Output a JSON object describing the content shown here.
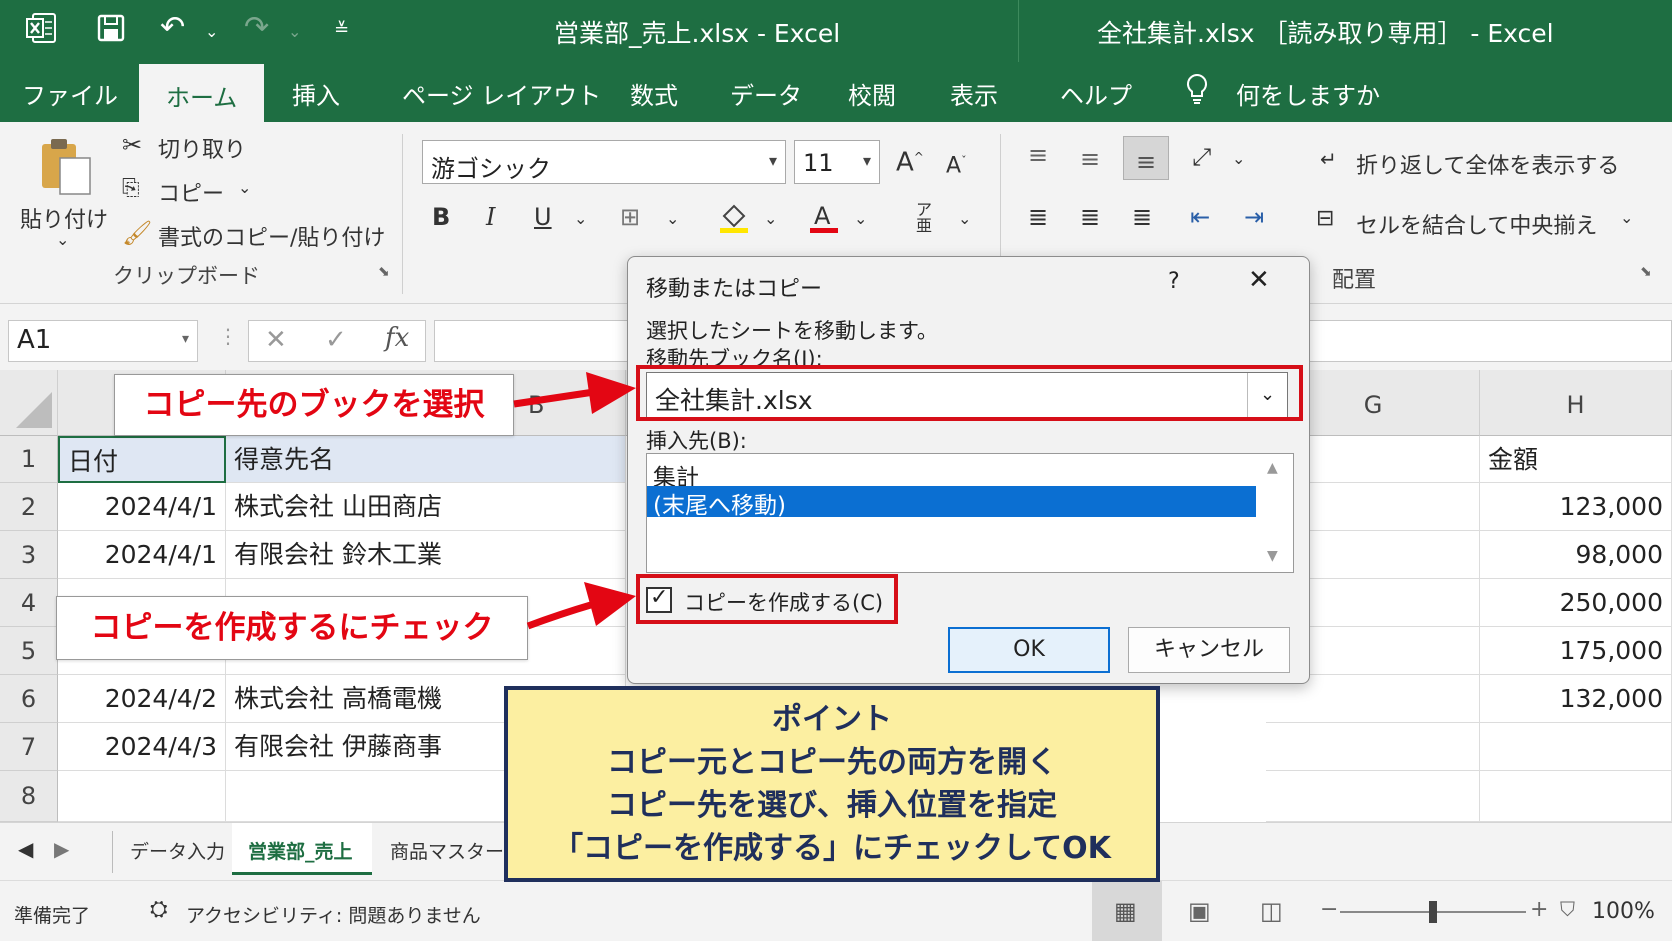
{
  "titlebar": {
    "left_title": "営業部_売上.xlsx  -  Excel",
    "right_title": "全社集計.xlsx ［読み取り専用］ -  Excel"
  },
  "tabs": [
    "ファイル",
    "ホーム",
    "挿入",
    "ページ レイアウト",
    "数式",
    "データ",
    "校閲",
    "表示",
    "ヘルプ"
  ],
  "tellme": "何をしますか",
  "clipboard": {
    "paste": "貼り付け",
    "cut": "切り取り",
    "copy": "コピー",
    "format_painter": "書式のコピー/貼り付け",
    "group": "クリップボード"
  },
  "font": {
    "name": "游ゴシック",
    "size": "11"
  },
  "alignment": {
    "wrap": "折り返して全体を表示する",
    "merge": "セルを結合して中央揃え",
    "group": "配置"
  },
  "namebox": "A1",
  "columns": {
    "b": "B",
    "g": "G",
    "h": "H"
  },
  "rows": [
    "1",
    "2",
    "3",
    "4",
    "5",
    "6",
    "7",
    "8"
  ],
  "cells": {
    "a1": "日付",
    "b1": "得意先名",
    "h1": "金額",
    "a2": "2024/4/1",
    "b2": "株式会社 山田商店",
    "h2": "123,000",
    "a3": "2024/4/1",
    "b3": "有限会社 鈴木工業",
    "h3": "98,000",
    "h4": "250,000",
    "h5": "175,000",
    "a6": "2024/4/2",
    "b6": "株式会社 高橋電機",
    "h6": "132,000",
    "a7": "2024/4/3",
    "b7": "有限会社 伊藤商事"
  },
  "sheets": [
    "データ入力",
    "営業部_売上",
    "商品マスター"
  ],
  "status": {
    "ready": "準備完了",
    "accessibility": "アクセシビリティ: 問題ありません",
    "zoom": "100%"
  },
  "dialog": {
    "title": "移動またはコピー",
    "help": "?",
    "instruction": "選択したシートを移動します。",
    "book_label": "移動先ブック名(I):",
    "book_value": "全社集計.xlsx",
    "before_label": "挿入先(B):",
    "list": [
      "集計",
      "(末尾へ移動)"
    ],
    "copy_label": "コピーを作成する(C)",
    "ok": "OK",
    "cancel": "キャンセル"
  },
  "annotations": {
    "callout1": "コピー先のブックを選択",
    "callout2": "コピーを作成するにチェック",
    "point": [
      "ポイント",
      "コピー元とコピー先の両方を開く",
      "コピー先を選び、挿入位置を指定",
      "「コピーを作成する」にチェックしてOK"
    ]
  },
  "colors": {
    "excel_green": "#1e6e42",
    "highlight_red": "#d60f18",
    "selection_blue": "#0b6fd2",
    "point_bg": "#fcefa1",
    "point_border": "#1f2f5c"
  }
}
